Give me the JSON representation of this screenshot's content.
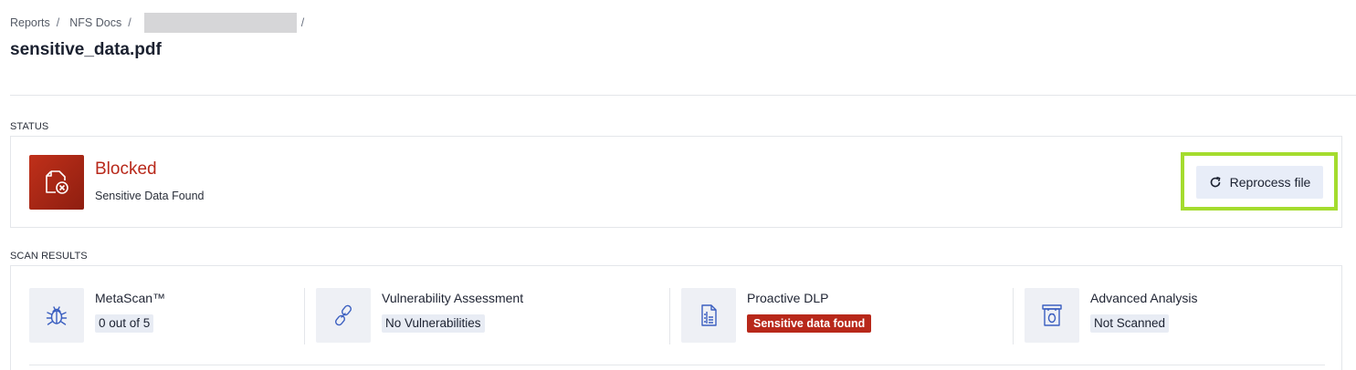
{
  "breadcrumb": {
    "items": [
      "Reports",
      "NFS Docs"
    ],
    "separator": "/"
  },
  "page": {
    "title": "sensitive_data.pdf"
  },
  "status": {
    "section_label": "STATUS",
    "title": "Blocked",
    "subtitle": "Sensitive Data Found",
    "icon": "blocked-file-icon",
    "reprocess_label": "Reprocess file",
    "reprocess_icon": "refresh-icon",
    "colors": {
      "blocked": "#b8281a",
      "highlight": "#a4dc2e"
    }
  },
  "scan_results": {
    "section_label": "SCAN RESULTS",
    "items": [
      {
        "title": "MetaScan™",
        "badge": "0 out of 5",
        "icon": "bug-icon"
      },
      {
        "title": "Vulnerability Assessment",
        "badge": "No Vulnerabilities",
        "icon": "chain-link-icon"
      },
      {
        "title": "Proactive DLP",
        "badge": "Sensitive data found",
        "icon": "document-scan-icon",
        "badge_color": "#b8281a"
      },
      {
        "title": "Advanced Analysis",
        "badge": "Not Scanned",
        "icon": "sandbox-icon"
      }
    ]
  }
}
